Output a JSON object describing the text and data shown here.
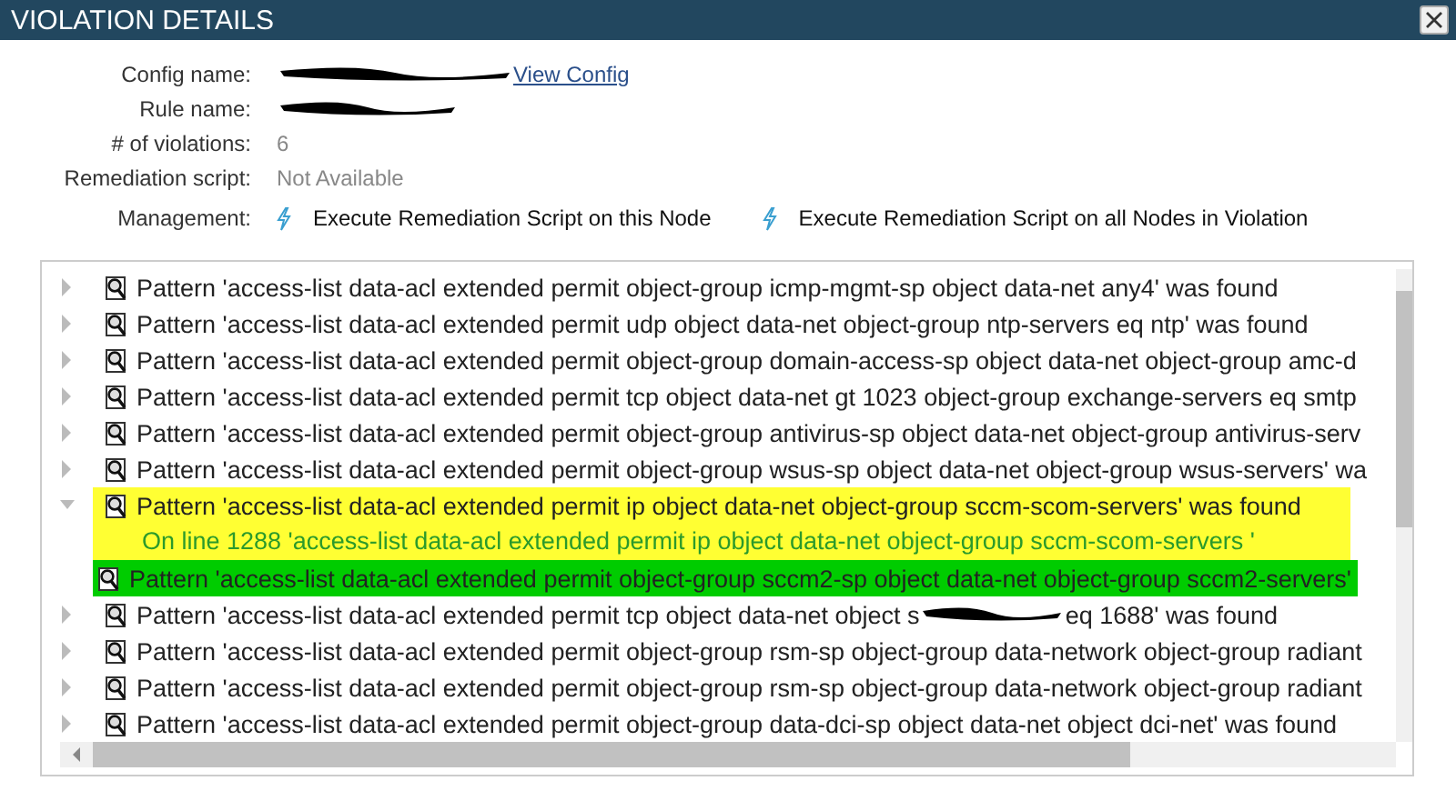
{
  "window": {
    "title": "VIOLATION DETAILS"
  },
  "details": [
    {
      "label": "Config name:",
      "redacted": true,
      "link": "View Config"
    },
    {
      "label": "Rule name:",
      "redacted": true
    },
    {
      "label": "# of violations:",
      "value": "6"
    },
    {
      "label": "Remediation script:",
      "value": "Not Available"
    }
  ],
  "management": {
    "label": "Management:",
    "actions": [
      "Execute Remediation Script on this Node",
      "Execute Remediation Script on all Nodes in Violation"
    ]
  },
  "tree": [
    {
      "label": "Pattern 'access-list data-acl extended permit object-group icmp-mgmt-sp object data-net any4' was found",
      "expanded": false,
      "selected": false
    },
    {
      "label": "Pattern 'access-list data-acl extended permit udp object data-net object-group ntp-servers eq ntp' was found",
      "expanded": false,
      "selected": false
    },
    {
      "label": "Pattern 'access-list data-acl extended permit object-group domain-access-sp object data-net object-group amc-d",
      "expanded": false,
      "selected": false
    },
    {
      "label": "Pattern 'access-list data-acl extended permit tcp object data-net gt 1023 object-group exchange-servers eq smtp",
      "expanded": false,
      "selected": false
    },
    {
      "label": "Pattern 'access-list data-acl extended permit object-group antivirus-sp object data-net object-group antivirus-serv",
      "expanded": false,
      "selected": false
    },
    {
      "label": "Pattern 'access-list data-acl extended permit object-group wsus-sp object data-net object-group wsus-servers' wa",
      "expanded": false,
      "selected": false
    },
    {
      "label": "Pattern 'access-list data-acl extended permit ip object data-net object-group sccm-scom-servers' was found",
      "expanded": true,
      "selected": true,
      "children": [
        {
          "kind": "detail",
          "text": "On line 1288 'access-list data-acl extended permit ip object data-net object-group sccm-scom-servers '",
          "hovered": false
        },
        {
          "kind": "pattern",
          "text": "Pattern 'access-list data-acl extended permit object-group sccm2-sp object data-net object-group sccm2-servers'",
          "hovered": true
        }
      ]
    },
    {
      "label": "Pattern 'access-list data-acl extended permit tcp object data-net object s",
      "redacted": true,
      "label_after": "eq 1688' was found",
      "expanded": false,
      "selected": false
    },
    {
      "label": "Pattern 'access-list data-acl extended permit object-group rsm-sp object-group data-network object-group radiant",
      "expanded": false,
      "selected": false
    },
    {
      "label": "Pattern 'access-list data-acl extended permit object-group rsm-sp object-group data-network object-group radiant",
      "expanded": false,
      "selected": false
    },
    {
      "label": "Pattern 'access-list data-acl extended permit object-group data-dci-sp object data-net object dci-net' was found",
      "expanded": false,
      "selected": false
    }
  ]
}
